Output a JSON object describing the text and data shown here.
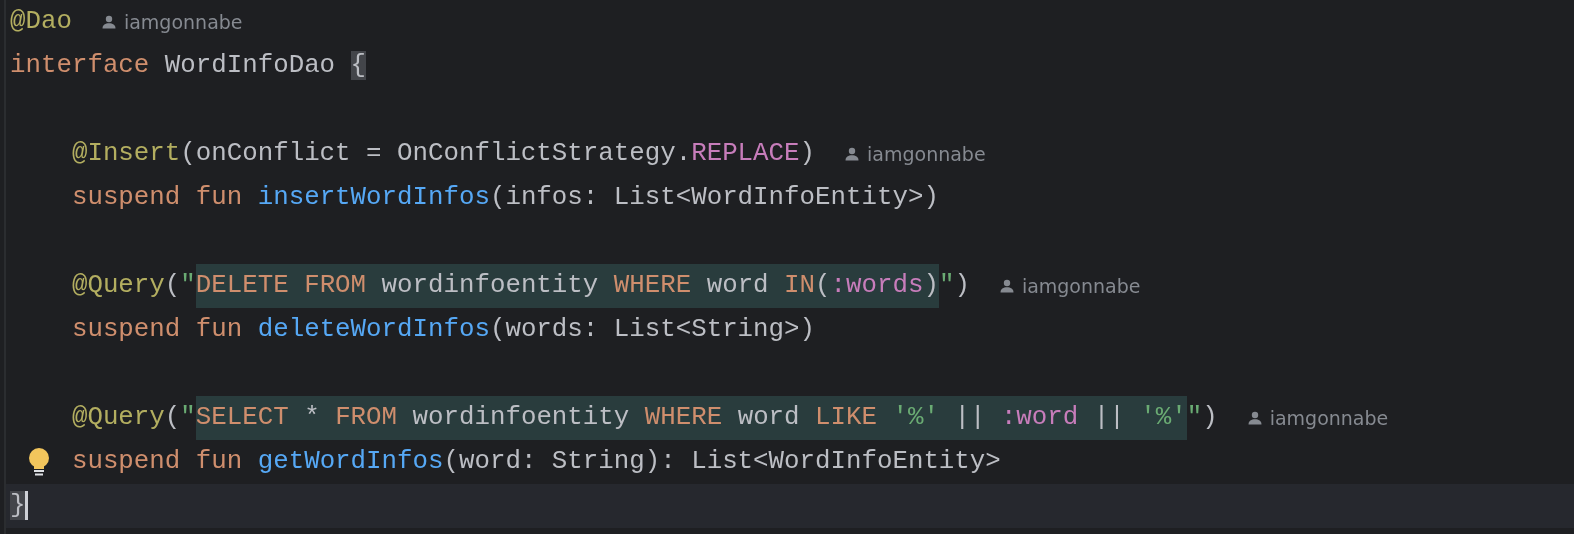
{
  "editor": {
    "lines": [
      {
        "tokens": [
          {
            "text": "@Dao",
            "kind": "annotation"
          }
        ],
        "author": "iamgonnabe",
        "bulb": false,
        "current": false
      },
      {
        "tokens": [
          {
            "text": "interface",
            "kind": "keyword"
          },
          {
            "text": " WordInfoDao ",
            "kind": "plain"
          },
          {
            "text": "{",
            "kind": "brace",
            "matched": true,
            "caret": false
          }
        ],
        "bulb": false,
        "current": false,
        "members": [
          {
            "lines": [
              {
                "tokens": [
                  {
                    "text": "@Insert",
                    "kind": "annotation"
                  },
                  {
                    "text": "(onConflict = OnConflictStrategy.",
                    "kind": "plain"
                  },
                  {
                    "text": "REPLACE",
                    "kind": "constant"
                  },
                  {
                    "text": ")",
                    "kind": "plain"
                  }
                ],
                "author": "iamgonnabe",
                "bulb": false,
                "current": false
              },
              {
                "tokens": [
                  {
                    "text": "suspend fun ",
                    "kind": "keyword"
                  },
                  {
                    "text": "insertWordInfos",
                    "kind": "function"
                  },
                  {
                    "text": "(infos: List<WordInfoEntity>)",
                    "kind": "plain"
                  }
                ],
                "bulb": false,
                "current": false
              }
            ]
          },
          {
            "lines": [
              {
                "tokens": [
                  {
                    "text": "@Query",
                    "kind": "annotation"
                  },
                  {
                    "text": "(",
                    "kind": "plain"
                  },
                  {
                    "text": "\"",
                    "kind": "string"
                  },
                  {
                    "kind": "injection",
                    "tokens": [
                      {
                        "text": "DELETE FROM",
                        "kind": "keyword"
                      },
                      {
                        "text": " wordinfoentity ",
                        "kind": "plain"
                      },
                      {
                        "text": "WHERE",
                        "kind": "keyword"
                      },
                      {
                        "text": " word ",
                        "kind": "plain"
                      },
                      {
                        "text": "IN",
                        "kind": "keyword"
                      },
                      {
                        "text": "(",
                        "kind": "plain"
                      },
                      {
                        "text": ":words",
                        "kind": "constant"
                      },
                      {
                        "text": ")",
                        "kind": "plain"
                      }
                    ]
                  },
                  {
                    "text": "\"",
                    "kind": "string"
                  },
                  {
                    "text": ")",
                    "kind": "plain"
                  }
                ],
                "author": "iamgonnabe",
                "bulb": false,
                "current": false
              },
              {
                "tokens": [
                  {
                    "text": "suspend fun ",
                    "kind": "keyword"
                  },
                  {
                    "text": "deleteWordInfos",
                    "kind": "function"
                  },
                  {
                    "text": "(words: List<String>)",
                    "kind": "plain"
                  }
                ],
                "bulb": false,
                "current": false
              }
            ]
          },
          {
            "lines": [
              {
                "tokens": [
                  {
                    "text": "@Query",
                    "kind": "annotation"
                  },
                  {
                    "text": "(",
                    "kind": "plain"
                  },
                  {
                    "text": "\"",
                    "kind": "string"
                  },
                  {
                    "kind": "injection",
                    "tokens": [
                      {
                        "text": "SELECT",
                        "kind": "keyword"
                      },
                      {
                        "text": " * ",
                        "kind": "plain"
                      },
                      {
                        "text": "FROM",
                        "kind": "keyword"
                      },
                      {
                        "text": " wordinfoentity ",
                        "kind": "plain"
                      },
                      {
                        "text": "WHERE",
                        "kind": "keyword"
                      },
                      {
                        "text": " word ",
                        "kind": "plain"
                      },
                      {
                        "text": "LIKE",
                        "kind": "keyword"
                      },
                      {
                        "text": " '%'",
                        "kind": "string"
                      },
                      {
                        "text": " || ",
                        "kind": "plain"
                      },
                      {
                        "text": ":word",
                        "kind": "constant"
                      },
                      {
                        "text": " || ",
                        "kind": "plain"
                      },
                      {
                        "text": "'%'",
                        "kind": "string"
                      }
                    ]
                  },
                  {
                    "text": "\"",
                    "kind": "string"
                  },
                  {
                    "text": ")",
                    "kind": "plain"
                  }
                ],
                "author": "iamgonnabe",
                "bulb": false,
                "current": false
              },
              {
                "tokens": [
                  {
                    "text": "suspend fun ",
                    "kind": "keyword"
                  },
                  {
                    "text": "getWordInfos",
                    "kind": "function"
                  },
                  {
                    "text": "(word: String): List<WordInfoEntity>",
                    "kind": "plain"
                  }
                ],
                "bulb": true,
                "current": false
              }
            ]
          }
        ]
      },
      {
        "tokens": [
          {
            "text": "}",
            "kind": "brace",
            "matched": true,
            "caret": true
          }
        ],
        "bulb": false,
        "current": true
      }
    ]
  }
}
